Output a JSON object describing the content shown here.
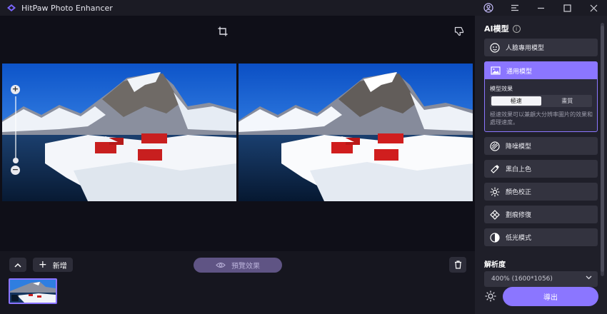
{
  "app": {
    "title": "HitPaw Photo Enhancer"
  },
  "colors": {
    "accent": "#8b76ff",
    "panel": "#1f1f29",
    "canvas": "#0f0f18"
  },
  "titlebar": {
    "icons": [
      "user-icon",
      "menu-icon",
      "minimize-icon",
      "maximize-icon",
      "close-icon"
    ]
  },
  "canvas": {
    "toolbar": {
      "crop_icon": "crop-icon",
      "feedback_icon": "thumbs-down-icon"
    },
    "zoom": {
      "plus": "+",
      "minus": "−"
    }
  },
  "bottom": {
    "add_label": "新增",
    "add_plus": "+",
    "preview_label": "預覽效果",
    "trash_icon": "trash-icon"
  },
  "panel": {
    "title": "AI模型",
    "models": [
      {
        "label": "人臉專用模型",
        "icon": "face-icon"
      },
      {
        "label": "通用模型",
        "icon": "image-icon",
        "active": true
      },
      {
        "label": "降噪模型",
        "icon": "denoise-icon"
      },
      {
        "label": "黑白上色",
        "icon": "colorize-icon"
      },
      {
        "label": "顏色校正",
        "icon": "color-correct-icon"
      },
      {
        "label": "劃痕修復",
        "icon": "scratch-repair-icon"
      },
      {
        "label": "低光模式",
        "icon": "low-light-icon"
      }
    ],
    "effect": {
      "label": "模型效果",
      "options": [
        "極速",
        "畫質"
      ],
      "selected": "極速",
      "description": "極速效果可以兼顧大分辨率圖片的效果和處理速度。"
    },
    "resolution": {
      "label": "解析度",
      "value": "400% (1600*1056)"
    },
    "export_label": "導出"
  }
}
